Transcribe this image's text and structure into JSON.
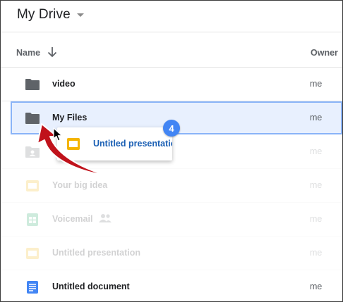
{
  "header": {
    "title": "My Drive"
  },
  "columns": {
    "name": "Name",
    "owner": "Owner"
  },
  "rows": [
    {
      "name": "video",
      "owner": "me",
      "type": "folder-icon"
    },
    {
      "name": "My Files",
      "owner": "me",
      "type": "folder-icon"
    },
    {
      "name": "",
      "owner": "me",
      "type": "contact-folder-icon"
    },
    {
      "name": "Your big idea",
      "owner": "me",
      "type": "slides-icon"
    },
    {
      "name": "Voicemail",
      "owner": "me",
      "type": "sheets-icon"
    },
    {
      "name": "Untitled presentation",
      "owner": "me",
      "type": "slides-icon"
    },
    {
      "name": "Untitled document",
      "owner": "me",
      "type": "docs-icon"
    }
  ],
  "drag": {
    "name": "Untitled presentation",
    "count": "4"
  },
  "colors": {
    "folder": "#5f6368",
    "slides": "#f4b400",
    "sheets": "#0f9d58",
    "docs": "#4285f4",
    "badge": "#4285f4",
    "arrow": "#c0121b",
    "selected_bg": "#e8f0fe"
  }
}
